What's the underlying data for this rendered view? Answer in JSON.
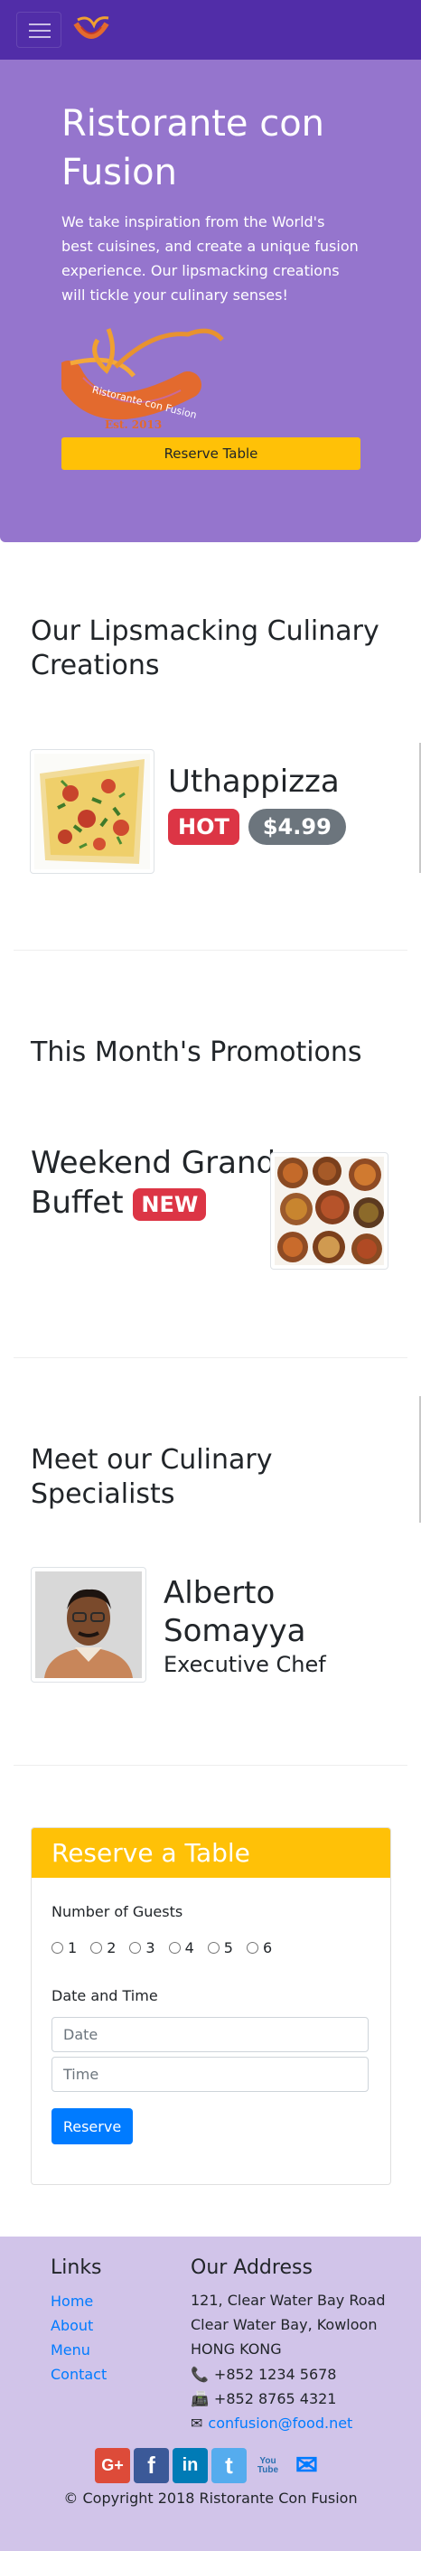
{
  "brand": {
    "name": "Ristorante con Fusion",
    "tagline": "We take inspiration from the World's best cuisines, and create a unique fusion experience. Our lipsmacking creations will tickle your culinary senses!",
    "logo_text": "Ristorante con Fusion",
    "logo_est": "Est. 2013",
    "reserve_label": "Reserve Table"
  },
  "colors": {
    "primary": "#512da8",
    "primary_light": "#9575cd",
    "footer": "#d1c4e9",
    "accent": "#ffc107",
    "danger": "#dc3545",
    "secondary": "#6c757d",
    "link": "#007bff"
  },
  "dish": {
    "heading": "Our Lipsmacking Culinary Creations",
    "name": "Uthappizza",
    "badge": "HOT",
    "price": "$4.99"
  },
  "promotion": {
    "heading": "This Month's Promotions",
    "name": "Weekend Grand Buffet",
    "badge": "NEW"
  },
  "leader": {
    "heading": "Meet our Culinary Specialists",
    "name": "Alberto Somayya",
    "designation": "Executive Chef"
  },
  "reserve": {
    "title": "Reserve a Table",
    "guests_label": "Number of Guests",
    "guest_options": [
      "1",
      "2",
      "3",
      "4",
      "5",
      "6"
    ],
    "datetime_label": "Date and Time",
    "date_placeholder": "Date",
    "time_placeholder": "Time",
    "submit_label": "Reserve"
  },
  "footer": {
    "links_heading": "Links",
    "links": [
      "Home",
      "About",
      "Menu",
      "Contact"
    ],
    "address_heading": "Our Address",
    "address": [
      "121, Clear Water Bay Road",
      "Clear Water Bay, Kowloon",
      "HONG KONG"
    ],
    "phone": "+852 1234 5678",
    "fax": "+852 8765 4321",
    "email": "confusion@food.net",
    "socials": [
      {
        "icon": "google-plus-icon",
        "glyph": "G+",
        "color": "#dd4b39"
      },
      {
        "icon": "facebook-icon",
        "glyph": "f",
        "color": "#3b5998"
      },
      {
        "icon": "linkedin-icon",
        "glyph": "in",
        "color": "#007bb6"
      },
      {
        "icon": "twitter-icon",
        "glyph": "t",
        "color": "#55acee"
      },
      {
        "icon": "youtube-icon",
        "glyph": "You Tube",
        "color": "#bb0000"
      },
      {
        "icon": "mail-icon",
        "glyph": "✉",
        "color": "#007bff"
      }
    ],
    "copyright": "© Copyright 2018 Ristorante Con Fusion"
  }
}
